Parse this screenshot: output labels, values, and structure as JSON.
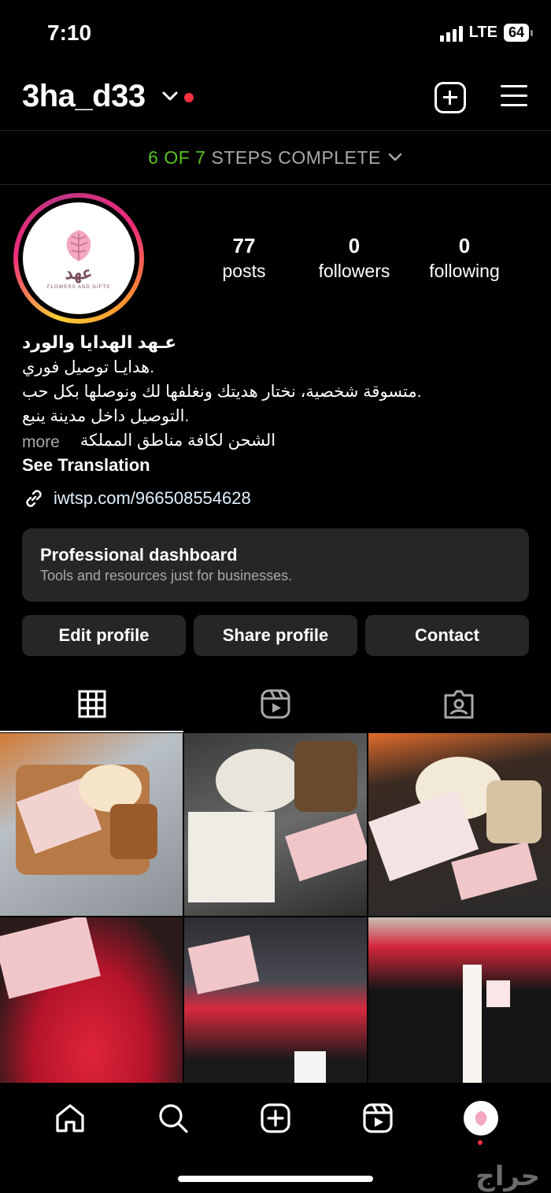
{
  "status_bar": {
    "time": "7:10",
    "network": "LTE",
    "battery": "64"
  },
  "header": {
    "username": "3ha_d33"
  },
  "steps": {
    "done": "6 OF 7",
    "text": "STEPS COMPLETE"
  },
  "profile": {
    "avatar_brand": "عهد",
    "avatar_sub": "FLOWERS AND GIFTS",
    "stats": [
      {
        "value": "77",
        "label": "posts"
      },
      {
        "value": "0",
        "label": "followers"
      },
      {
        "value": "0",
        "label": "following"
      }
    ],
    "name": "عـهد الهدايا والورد",
    "bio_lines": [
      "هدايـا توصيل فوري.",
      "متسوقة شخصية، نختار هديتك ونغلفها لك ونوصلها بكل حب.",
      "التوصيل داخل مدينة ينبع.",
      "الشحن لكافة مناطق المملكة"
    ],
    "more": "more",
    "see_translation": "See Translation",
    "link": "iwtsp.com/966508554628"
  },
  "dashboard": {
    "title": "Professional dashboard",
    "desc": "Tools and resources just for businesses."
  },
  "actions": {
    "edit": "Edit profile",
    "share": "Share profile",
    "contact": "Contact"
  },
  "tabs": [
    "grid-icon",
    "reels-icon",
    "tagged-icon"
  ],
  "grid_posts": [
    "gift-box-with-roses-and-iced-coffee",
    "gift-box-with-white-roses-and-coffee",
    "gift-box-tray-with-roses-and-coffee",
    "red-roses-bouquet-with-card",
    "red-roses-box-in-car",
    "valentines-red-roses-black-box"
  ],
  "bottom_nav": [
    "home-icon",
    "search-icon",
    "create-icon",
    "reels-icon",
    "profile-avatar"
  ],
  "watermark": "حراج",
  "colors": {
    "accent_green": "#58c322",
    "live_red": "#ff3040",
    "surface": "#262626",
    "muted": "#a8a8a8"
  }
}
